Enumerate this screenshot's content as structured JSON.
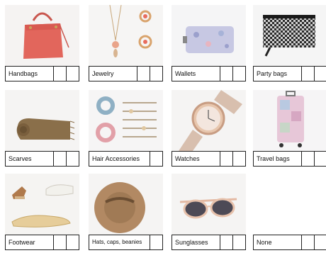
{
  "items": [
    {
      "label": "Handbags",
      "icon": "handbag-icon"
    },
    {
      "label": "Jewelry",
      "icon": "jewelry-icon"
    },
    {
      "label": "Wallets",
      "icon": "wallet-icon"
    },
    {
      "label": "Party bags",
      "icon": "party-bag-icon"
    },
    {
      "label": "Scarves",
      "icon": "scarf-icon"
    },
    {
      "label": "Hair Accessories",
      "icon": "hair-accessories-icon"
    },
    {
      "label": "Watches",
      "icon": "watch-icon"
    },
    {
      "label": "Travel bags",
      "icon": "suitcase-icon"
    },
    {
      "label": "Footwear",
      "icon": "shoes-icon"
    },
    {
      "label": "Hats, caps, beanies",
      "icon": "hat-icon"
    },
    {
      "label": "Sunglasses",
      "icon": "sunglasses-icon"
    },
    {
      "label": "None",
      "icon": ""
    }
  ]
}
